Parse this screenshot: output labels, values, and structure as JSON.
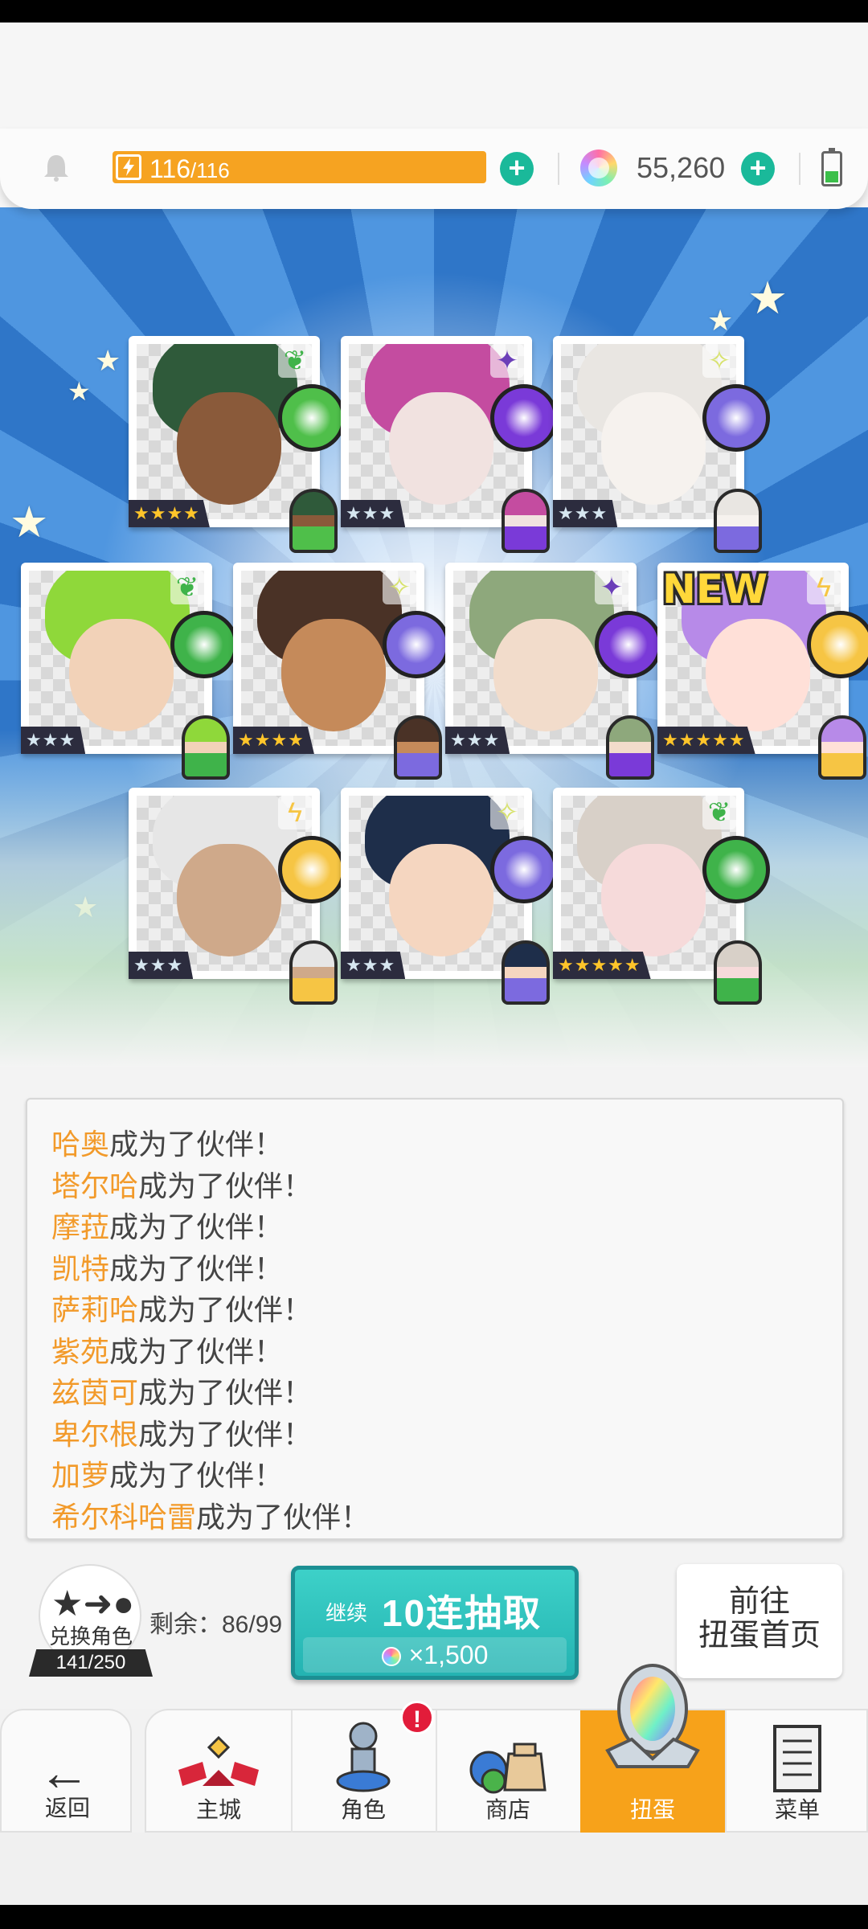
{
  "header": {
    "energy_current": "116",
    "energy_max": "/116",
    "gems": "55,260",
    "battery_level": 0.3
  },
  "cards": [
    {
      "rarity": "★★★★",
      "element": "leaf",
      "gold": true
    },
    {
      "rarity": "★★★",
      "element": "dark",
      "gold": false
    },
    {
      "rarity": "★★★",
      "element": "light",
      "gold": false
    },
    {
      "rarity": "★★★",
      "element": "leaf",
      "gold": false
    },
    {
      "rarity": "★★★★",
      "element": "light",
      "gold": true
    },
    {
      "rarity": "★★★",
      "element": "dark",
      "gold": false
    },
    {
      "rarity": "★★★★★",
      "element": "thunder",
      "gold": true,
      "new": "NEW"
    },
    {
      "rarity": "★★★",
      "element": "thunder",
      "gold": false
    },
    {
      "rarity": "★★★",
      "element": "light",
      "gold": false
    },
    {
      "rarity": "★★★★★",
      "element": "leaf",
      "gold": true
    }
  ],
  "messages": [
    {
      "name": "哈奥",
      "text": "成为了伙伴！"
    },
    {
      "name": "塔尔哈",
      "text": "成为了伙伴！"
    },
    {
      "name": "摩菈",
      "text": "成为了伙伴！"
    },
    {
      "name": "凯特",
      "text": "成为了伙伴！"
    },
    {
      "name": "萨莉哈",
      "text": "成为了伙伴！"
    },
    {
      "name": "紫苑",
      "text": "成为了伙伴！"
    },
    {
      "name": "兹茵可",
      "text": "成为了伙伴！"
    },
    {
      "name": "卑尔根",
      "text": "成为了伙伴！"
    },
    {
      "name": "加萝",
      "text": "成为了伙伴！"
    },
    {
      "name": "希尔科哈雷",
      "text": "成为了伙伴！"
    }
  ],
  "action": {
    "exchange_label": "兑换角色",
    "exchange_count": "141/250",
    "remaining": "剩余：86/99",
    "draw_continue": "继续",
    "draw_label": "10连抽取",
    "draw_cost": "×1,500",
    "goto_line1": "前往",
    "goto_line2": "扭蛋首页"
  },
  "nav": {
    "back": "返回",
    "items": [
      "主城",
      "角色",
      "商店",
      "扭蛋",
      "菜单"
    ],
    "active_index": 3,
    "badge": "!"
  },
  "colors": {
    "accent_orange": "#f7a21a",
    "teal": "#24b3b2",
    "name_orange": "#f29a2a"
  }
}
